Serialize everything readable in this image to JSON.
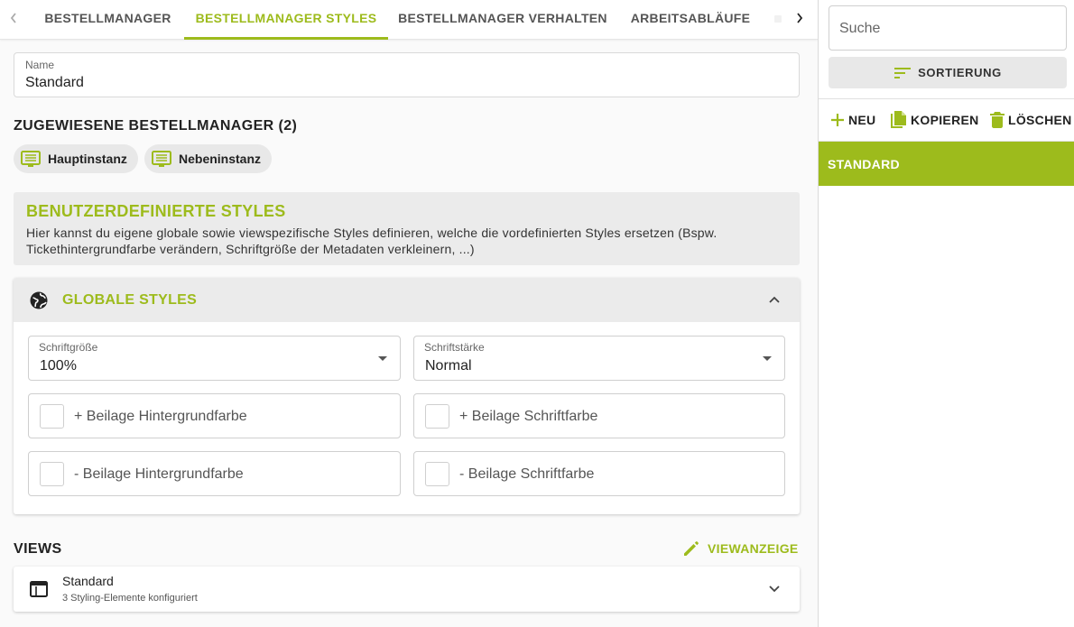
{
  "colors": {
    "accent": "#9dbb1c",
    "chip_bg": "#e8e8e8",
    "panel_bg": "#ebebeb"
  },
  "tabs": [
    {
      "label": "BESTELLMANAGER",
      "active": false
    },
    {
      "label": "BESTELLMANAGER STYLES",
      "active": true
    },
    {
      "label": "BESTELLMANAGER VERHALTEN",
      "active": false
    },
    {
      "label": "ARBEITSABLÄUFE",
      "active": false
    }
  ],
  "name_field": {
    "label": "Name",
    "value": "Standard"
  },
  "assigned": {
    "title": "ZUGEWIESENE BESTELLMANAGER (2)",
    "chips": [
      {
        "label": "Hauptinstanz",
        "icon": "monitor-list-icon"
      },
      {
        "label": "Nebeninstanz",
        "icon": "monitor-list-icon"
      }
    ]
  },
  "info": {
    "title": "BENUTZERDEFINIERTE STYLES",
    "text": "Hier kannst du eigene globale sowie viewspezifische Styles definieren, welche die vordefinierten Styles ersetzen (Bspw. Tickethintergrundfarbe verändern, Schriftgröße der Metadaten verkleinern, ...)"
  },
  "global_styles": {
    "title": "GLOBALE STYLES",
    "icon": "globe-icon",
    "font_size": {
      "label": "Schriftgröße",
      "value": "100%"
    },
    "font_weight": {
      "label": "Schriftstärke",
      "value": "Normal"
    },
    "colors": [
      {
        "label": "+ Beilage Hintergrundfarbe"
      },
      {
        "label": "+ Beilage Schriftfarbe"
      },
      {
        "label": "- Beilage Hintergrundfarbe"
      },
      {
        "label": "- Beilage Schriftfarbe"
      }
    ]
  },
  "views": {
    "title": "VIEWS",
    "action_label": "VIEWANZEIGE",
    "items": [
      {
        "title": "Standard",
        "subtitle": "3 Styling-Elemente konfiguriert",
        "icon": "window-icon"
      }
    ]
  },
  "sidebar": {
    "search_placeholder": "Suche",
    "sort_label": "SORTIERUNG",
    "actions": {
      "new": "NEU",
      "copy": "KOPIEREN",
      "delete": "LÖSCHEN"
    },
    "items": [
      {
        "label": "STANDARD",
        "selected": true
      }
    ]
  }
}
